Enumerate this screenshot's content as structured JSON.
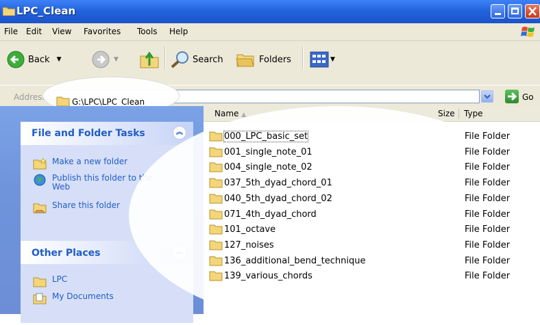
{
  "window": {
    "title": "LPC_Clean"
  },
  "menu": [
    "File",
    "Edit",
    "View",
    "Favorites",
    "Tools",
    "Help"
  ],
  "toolbar": {
    "back": "Back",
    "search": "Search",
    "folders": "Folders"
  },
  "address": {
    "label": "Address",
    "path": "G:\\LPC\\LPC_Clean",
    "go": "Go"
  },
  "tasks_panel": {
    "title": "File and Folder Tasks",
    "items": [
      "Make a new folder",
      "Publish this folder to the Web",
      "Share this folder"
    ]
  },
  "places_panel": {
    "title": "Other Places",
    "items": [
      "LPC",
      "My Documents"
    ]
  },
  "columns": {
    "name": "Name",
    "size": "Size",
    "type": "Type"
  },
  "files": [
    {
      "name": "000_LPC_basic_set",
      "type": "File Folder"
    },
    {
      "name": "001_single_note_01",
      "type": "File Folder"
    },
    {
      "name": "004_single_note_02",
      "type": "File Folder"
    },
    {
      "name": "037_5th_dyad_chord_01",
      "type": "File Folder"
    },
    {
      "name": "040_5th_dyad_chord_02",
      "type": "File Folder"
    },
    {
      "name": "071_4th_dyad_chord",
      "type": "File Folder"
    },
    {
      "name": "101_octave",
      "type": "File Folder"
    },
    {
      "name": "127_noises",
      "type": "File Folder"
    },
    {
      "name": "136_additional_bend_technique",
      "type": "File Folder"
    },
    {
      "name": "139_various_chords",
      "type": "File Folder"
    }
  ]
}
